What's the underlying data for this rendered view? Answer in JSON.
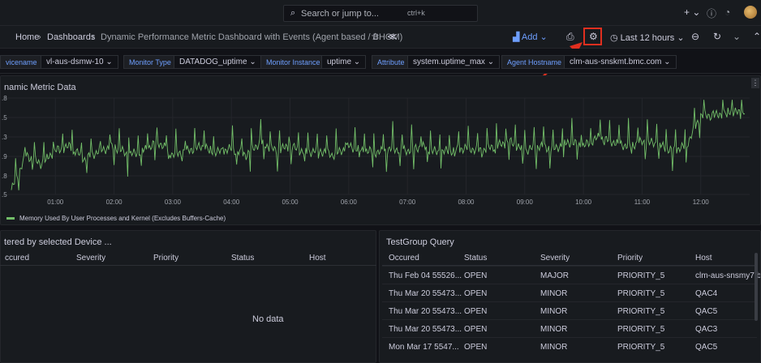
{
  "topbar": {
    "search_placeholder": "Search or jump to...",
    "shortcut": "ctrl+k",
    "plus_icon": "+ ⌄",
    "help_icon": "?",
    "news_icon": "rss",
    "avatar_label": "user avatar"
  },
  "nav": {
    "breadcrumb": [
      "Home",
      "Dashboards",
      "Dynamic Performance Metric Dashboard with Events (Agent based / BHOM)"
    ],
    "add_label": "Add",
    "time_range": "Last 12 hours"
  },
  "variables": [
    {
      "label": "vicename",
      "value": "vl-aus-dsmw-10"
    },
    {
      "label": "Monitor Type",
      "value": "DATADOG_uptime"
    },
    {
      "label": "Monitor Instance",
      "value": "uptime"
    },
    {
      "label": "Attribute",
      "value": "system.uptime_max"
    },
    {
      "label": "Agent Hostname",
      "value": "clm-aus-snskmt.bmc.com"
    }
  ],
  "chart_panel": {
    "title": "namic Metric Data",
    "legend": "Memory Used By User Processes and Kernel (Excludes Buffers-Cache)",
    "line_color": "#73bf69"
  },
  "chart_data": {
    "type": "line",
    "title": "namic Metric Data",
    "x_ticks": [
      "01:00",
      "02:00",
      "03:00",
      "04:00",
      "05:00",
      "06:00",
      "07:00",
      "08:00",
      "09:00",
      "10:00",
      "11:00",
      "12:00"
    ],
    "y_ticks": [
      ".8",
      ".5",
      ".3",
      ".9",
      ".8",
      ".5"
    ],
    "series": [
      {
        "name": "Memory Used By User Processes and Kernel (Excludes Buffers-Cache)",
        "color": "#73bf69",
        "x": [
          "00:15",
          "00:30",
          "00:45",
          "01:00",
          "01:15",
          "01:30",
          "01:45",
          "02:00",
          "02:15",
          "02:30",
          "02:45",
          "03:00",
          "03:15",
          "03:30",
          "03:45",
          "04:00",
          "04:15",
          "04:30",
          "04:45",
          "05:00",
          "05:15",
          "05:30",
          "05:45",
          "06:00",
          "06:15",
          "06:30",
          "06:45",
          "07:00",
          "07:15",
          "07:30",
          "07:45",
          "08:00",
          "08:15",
          "08:30",
          "08:45",
          "09:00",
          "09:15",
          "09:30",
          "09:45",
          "10:00",
          "10:15",
          "10:30",
          "10:45",
          "11:00",
          "11:15",
          "11:30",
          "11:45",
          "12:00",
          "12:15",
          "12:30",
          "12:45"
        ],
        "values": [
          0.55,
          0.95,
          0.85,
          1.0,
          1.05,
          0.9,
          1.0,
          1.05,
          0.95,
          1.0,
          1.1,
          0.95,
          1.0,
          1.05,
          0.98,
          1.02,
          0.95,
          1.1,
          1.0,
          1.05,
          0.98,
          1.0,
          0.95,
          1.05,
          1.0,
          0.98,
          1.02,
          1.0,
          1.05,
          0.98,
          1.0,
          1.03,
          1.0,
          1.05,
          1.1,
          1.0,
          1.05,
          1.02,
          1.1,
          1.05,
          1.15,
          1.1,
          1.05,
          1.1,
          1.08,
          1.0,
          1.05,
          1.4,
          1.4,
          1.45,
          1.42
        ]
      }
    ]
  },
  "events_panel": {
    "title": "tered by selected Device ...",
    "columns": [
      "ccured",
      "Severity",
      "Priority",
      "Status",
      "Host"
    ],
    "empty_text": "No data"
  },
  "testgroup_panel": {
    "title": "TestGroup Query",
    "columns": [
      "Occured",
      "Status",
      "Severity",
      "Priority",
      "Host"
    ],
    "rows": [
      [
        "Thu Feb 04 55526...",
        "OPEN",
        "MAJOR",
        "PRIORITY_5",
        "clm-aus-snsmy7.b"
      ],
      [
        "Thu Mar 20 55473...",
        "OPEN",
        "MINOR",
        "PRIORITY_5",
        "QAC4"
      ],
      [
        "Thu Mar 20 55473...",
        "OPEN",
        "MINOR",
        "PRIORITY_5",
        "QAC5"
      ],
      [
        "Thu Mar 20 55473...",
        "OPEN",
        "MINOR",
        "PRIORITY_5",
        "QAC3"
      ],
      [
        "Mon Mar 17 5547...",
        "OPEN",
        "MINOR",
        "PRIORITY_5",
        "QAC5"
      ]
    ]
  },
  "colors": {
    "accent": "#6e9fff",
    "highlight": "#e02f1f",
    "series": "#73bf69"
  }
}
